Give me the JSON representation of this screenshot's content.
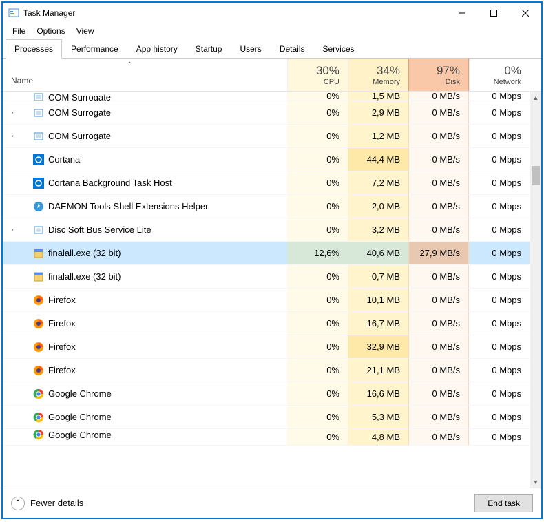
{
  "window": {
    "title": "Task Manager"
  },
  "menu": {
    "file": "File",
    "options": "Options",
    "view": "View"
  },
  "tabs": {
    "processes": "Processes",
    "performance": "Performance",
    "app_history": "App history",
    "startup": "Startup",
    "users": "Users",
    "details": "Details",
    "services": "Services"
  },
  "header": {
    "name": "Name",
    "cpu_pct": "30%",
    "cpu_lbl": "CPU",
    "mem_pct": "34%",
    "mem_lbl": "Memory",
    "disk_pct": "97%",
    "disk_lbl": "Disk",
    "net_pct": "0%",
    "net_lbl": "Network"
  },
  "rows": [
    {
      "exp": false,
      "icon": "com",
      "name": "COM Surrogate",
      "cpu": "0%",
      "mem": "1,5 MB",
      "disk": "0 MB/s",
      "net": "0 Mbps",
      "cut": true
    },
    {
      "exp": true,
      "icon": "com",
      "name": "COM Surrogate",
      "cpu": "0%",
      "mem": "2,9 MB",
      "disk": "0 MB/s",
      "net": "0 Mbps"
    },
    {
      "exp": true,
      "icon": "com",
      "name": "COM Surrogate",
      "cpu": "0%",
      "mem": "1,2 MB",
      "disk": "0 MB/s",
      "net": "0 Mbps"
    },
    {
      "exp": false,
      "icon": "cortana",
      "name": "Cortana",
      "cpu": "0%",
      "mem": "44,4 MB",
      "disk": "0 MB/s",
      "net": "0 Mbps"
    },
    {
      "exp": false,
      "icon": "cortana",
      "name": "Cortana Background Task Host",
      "cpu": "0%",
      "mem": "7,2 MB",
      "disk": "0 MB/s",
      "net": "0 Mbps"
    },
    {
      "exp": false,
      "icon": "daemon",
      "name": "DAEMON Tools Shell Extensions Helper",
      "cpu": "0%",
      "mem": "2,0 MB",
      "disk": "0 MB/s",
      "net": "0 Mbps"
    },
    {
      "exp": true,
      "icon": "disc",
      "name": "Disc Soft Bus Service Lite",
      "cpu": "0%",
      "mem": "3,2 MB",
      "disk": "0 MB/s",
      "net": "0 Mbps"
    },
    {
      "exp": false,
      "icon": "file",
      "name": "finalall.exe (32 bit)",
      "cpu": "12,6%",
      "mem": "40,6 MB",
      "disk": "27,9 MB/s",
      "net": "0 Mbps",
      "sel": true
    },
    {
      "exp": false,
      "icon": "file",
      "name": "finalall.exe (32 bit)",
      "cpu": "0%",
      "mem": "0,7 MB",
      "disk": "0 MB/s",
      "net": "0 Mbps"
    },
    {
      "exp": false,
      "icon": "firefox",
      "name": "Firefox",
      "cpu": "0%",
      "mem": "10,1 MB",
      "disk": "0 MB/s",
      "net": "0 Mbps"
    },
    {
      "exp": false,
      "icon": "firefox",
      "name": "Firefox",
      "cpu": "0%",
      "mem": "16,7 MB",
      "disk": "0 MB/s",
      "net": "0 Mbps"
    },
    {
      "exp": false,
      "icon": "firefox",
      "name": "Firefox",
      "cpu": "0%",
      "mem": "32,9 MB",
      "disk": "0 MB/s",
      "net": "0 Mbps"
    },
    {
      "exp": false,
      "icon": "firefox",
      "name": "Firefox",
      "cpu": "0%",
      "mem": "21,1 MB",
      "disk": "0 MB/s",
      "net": "0 Mbps"
    },
    {
      "exp": false,
      "icon": "chrome",
      "name": "Google Chrome",
      "cpu": "0%",
      "mem": "16,6 MB",
      "disk": "0 MB/s",
      "net": "0 Mbps"
    },
    {
      "exp": false,
      "icon": "chrome",
      "name": "Google Chrome",
      "cpu": "0%",
      "mem": "5,3 MB",
      "disk": "0 MB/s",
      "net": "0 Mbps"
    },
    {
      "exp": false,
      "icon": "chrome",
      "name": "Google Chrome",
      "cpu": "0%",
      "mem": "4,8 MB",
      "disk": "0 MB/s",
      "net": "0 Mbps",
      "cut2": true
    }
  ],
  "footer": {
    "fewer": "Fewer details",
    "end": "End task"
  }
}
